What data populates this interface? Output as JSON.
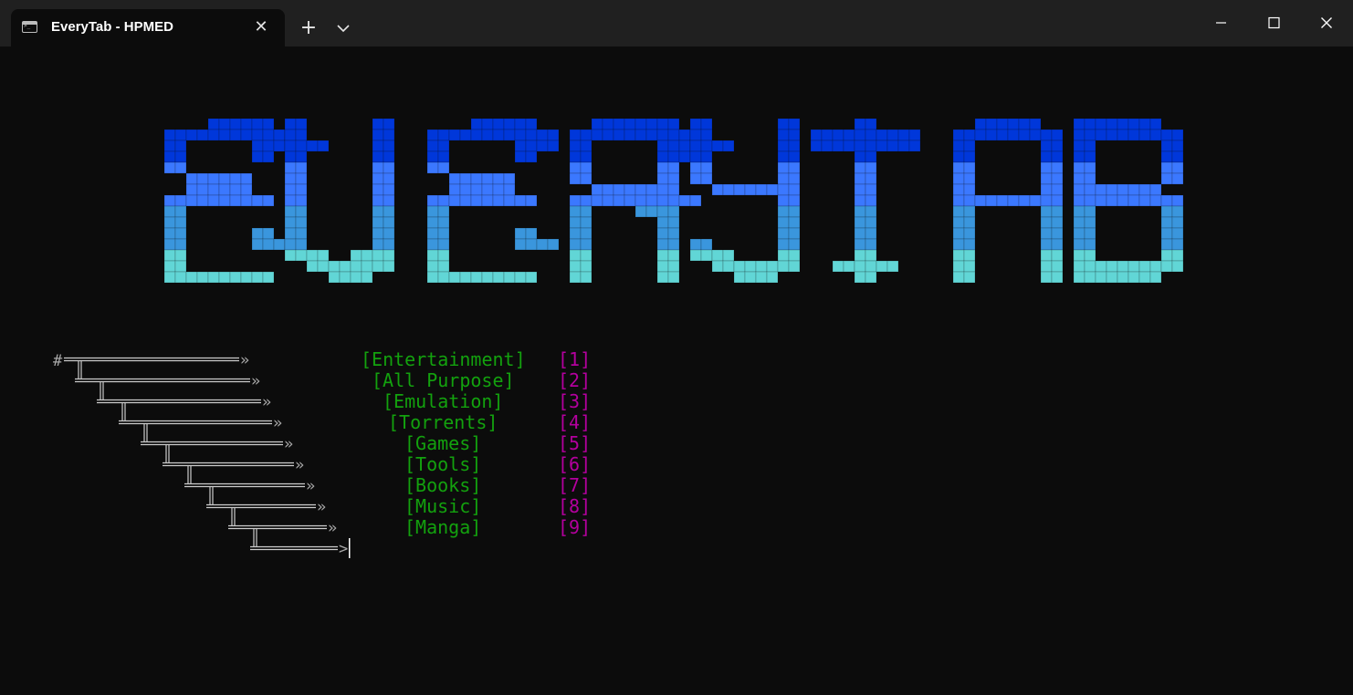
{
  "window": {
    "tab_title": "EveryTab - HPMED",
    "tab_close_glyph": "✕",
    "new_tab_glyph": "+"
  },
  "banner": {
    "text": "EVERYTAB",
    "band_colors": [
      "#0037da",
      "#3b78ff",
      "#3a96dd",
      "#61d6d6"
    ]
  },
  "menu": {
    "items": [
      {
        "label": "[Entertainment]",
        "key": "[1]"
      },
      {
        "label": "[All Purpose]",
        "key": "[2]"
      },
      {
        "label": "[Emulation]",
        "key": "[3]"
      },
      {
        "label": "[Torrents]",
        "key": "[4]"
      },
      {
        "label": "[Games]",
        "key": "[5]"
      },
      {
        "label": "[Tools]",
        "key": "[6]"
      },
      {
        "label": "[Books]",
        "key": "[7]"
      },
      {
        "label": "[Music]",
        "key": "[8]"
      },
      {
        "label": "[Manga]",
        "key": "[9]"
      }
    ],
    "label_color": "#13a10e",
    "key_color": "#b4009e"
  },
  "tree": {
    "root_glyph": "#",
    "arrow_glyph": "»",
    "final_arrow_glyph": ">",
    "line_color": "#cccccc"
  }
}
